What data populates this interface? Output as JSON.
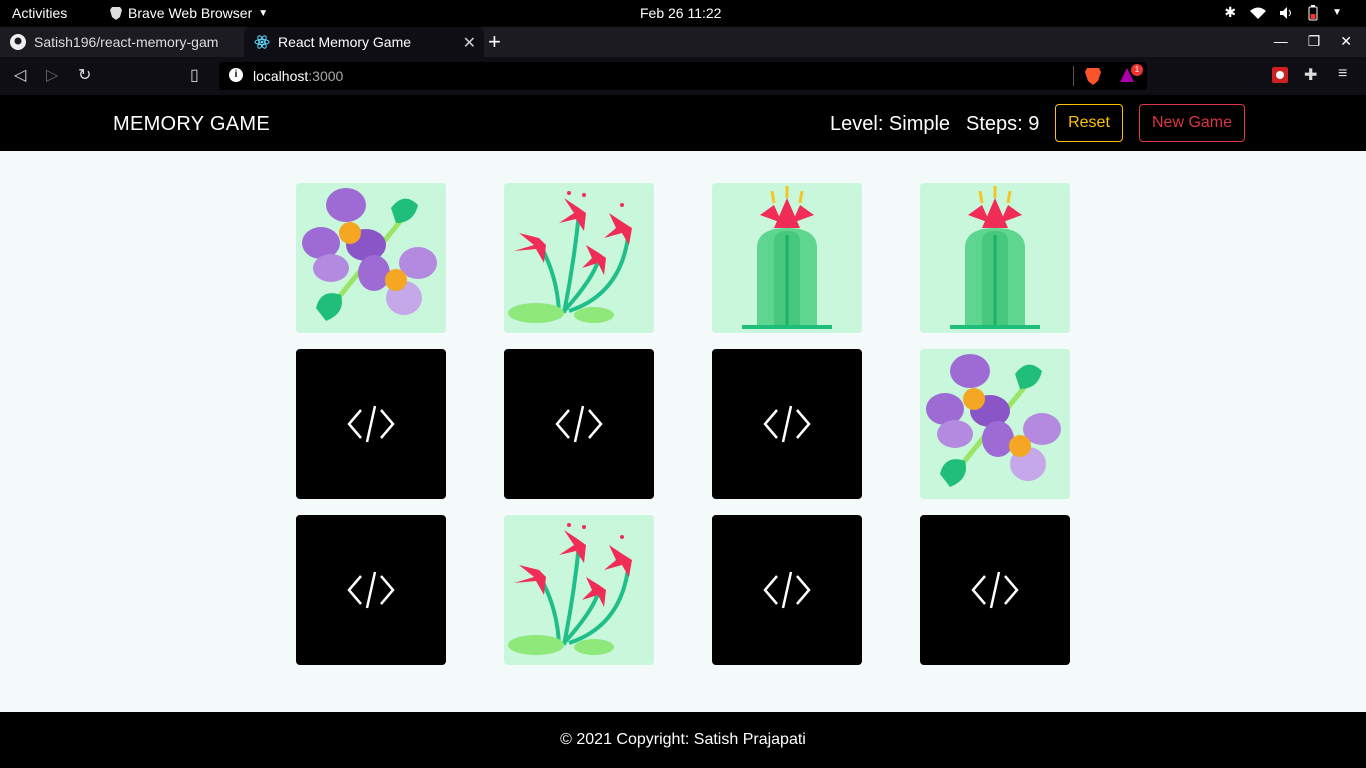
{
  "os": {
    "activities": "Activities",
    "app_name": "Brave Web Browser",
    "clock": "Feb 26  11:22"
  },
  "browser": {
    "tabs": [
      {
        "label": "Satish196/react-memory-gam",
        "icon": "github-icon"
      },
      {
        "label": "React Memory Game",
        "icon": "react-icon"
      }
    ],
    "address": {
      "host": "localhost",
      "port": ":3000"
    },
    "shields_badge": "1"
  },
  "app": {
    "title": "MEMORY GAME",
    "level": "Level: Simple",
    "steps": "Steps: 9",
    "reset_label": "Reset",
    "new_game_label": "New Game",
    "colors": {
      "reset": "#ffc107",
      "new_game": "#dc3545",
      "card_face": "#c9f7dc"
    }
  },
  "cards": [
    {
      "state": "shown",
      "image": "purple-flower"
    },
    {
      "state": "shown",
      "image": "red-flower"
    },
    {
      "state": "shown",
      "image": "cactus"
    },
    {
      "state": "shown",
      "image": "cactus"
    },
    {
      "state": "hidden",
      "icon": "code-icon"
    },
    {
      "state": "hidden",
      "icon": "code-icon"
    },
    {
      "state": "hidden",
      "icon": "code-icon"
    },
    {
      "state": "shown",
      "image": "purple-flower"
    },
    {
      "state": "hidden",
      "icon": "code-icon"
    },
    {
      "state": "shown",
      "image": "red-flower"
    },
    {
      "state": "hidden",
      "icon": "code-icon"
    },
    {
      "state": "hidden",
      "icon": "code-icon"
    }
  ],
  "footer": {
    "text": "© 2021 Copyright: Satish Prajapati"
  }
}
